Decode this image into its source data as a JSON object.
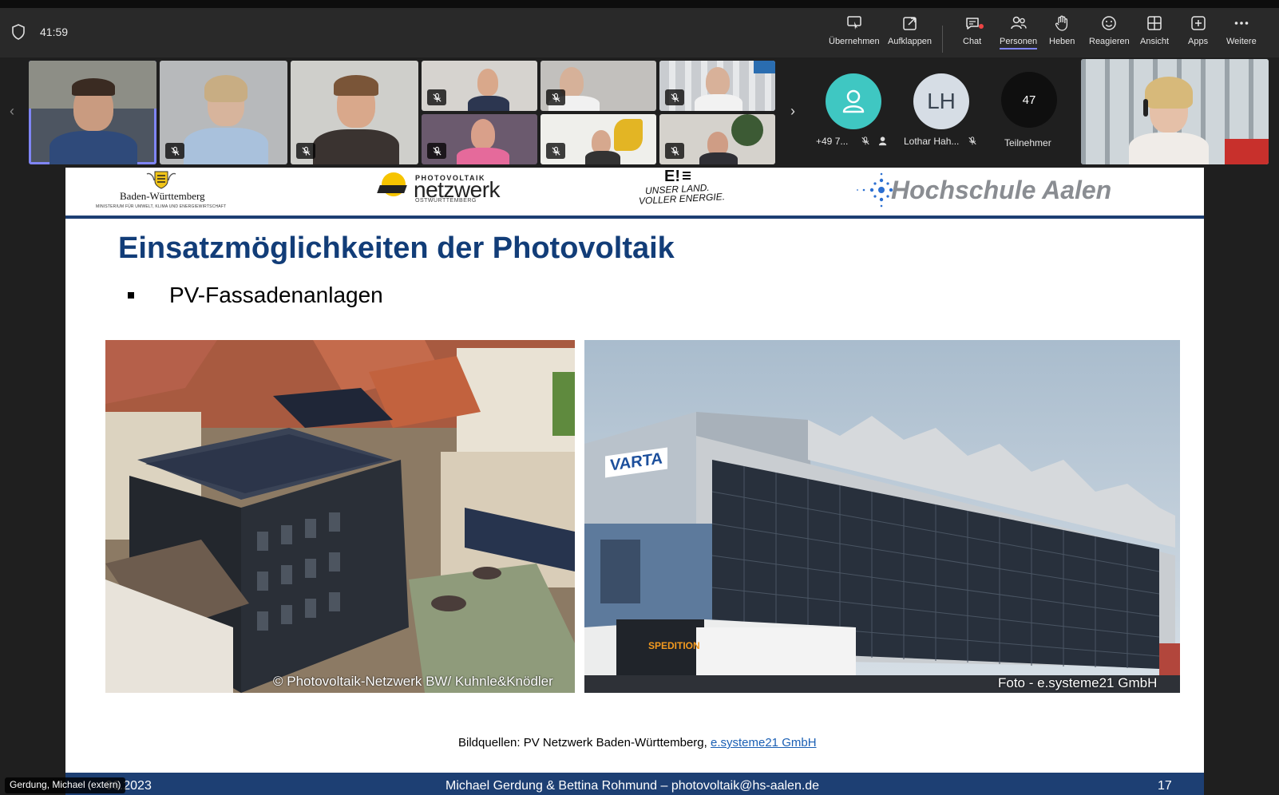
{
  "meeting": {
    "timer": "41:59"
  },
  "toolbar": {
    "buttons": [
      {
        "id": "take-control",
        "label": "Übernehmen",
        "icon": "take-control-icon"
      },
      {
        "id": "pop-out",
        "label": "Aufklappen",
        "icon": "pop-out-icon"
      },
      {
        "id": "chat",
        "label": "Chat",
        "icon": "chat-icon"
      },
      {
        "id": "people",
        "label": "Personen",
        "icon": "people-icon"
      },
      {
        "id": "raise",
        "label": "Heben",
        "icon": "raise-hand-icon"
      },
      {
        "id": "react",
        "label": "Reagieren",
        "icon": "react-icon"
      },
      {
        "id": "view",
        "label": "Ansicht",
        "icon": "view-icon"
      },
      {
        "id": "apps",
        "label": "Apps",
        "icon": "apps-icon"
      },
      {
        "id": "more",
        "label": "Weitere",
        "icon": "more-icon"
      }
    ],
    "active": "Personen",
    "colors": {
      "accent": "#7f85f5",
      "notification": "#e44444"
    }
  },
  "participants_strip": {
    "phone_avatar_label": "+49 7...",
    "lh_initials": "LH",
    "lh_label": "Lothar Hah...",
    "count": "47",
    "count_label": "Teilnehmer"
  },
  "slide": {
    "logos": {
      "bw_name": "Baden-Württemberg",
      "bw_sub": "MINISTERIUM FÜR UMWELT, KLIMA UND ENERGIEWIRTSCHAFT",
      "pv_top": "PHOTOVOLTAIK",
      "pv_main": "netzwerk",
      "pv_sub": "OSTWÜRTTEMBERG",
      "ee_mark": "E!",
      "ee_line1": "UNSER LAND.",
      "ee_line2": "VOLLER ENERGIE.",
      "hs_name": "Hochschule Aalen"
    },
    "title": "Einsatzmöglichkeiten der Photovoltaik",
    "bullet": "PV-Fassadenanlagen",
    "photo_left_caption": "© Photovoltaik-Netzwerk BW/ Kuhnle&Knödler",
    "photo_right_caption": "Foto - e.systeme21 GmbH",
    "photo_right_varta": "VARTA",
    "photo_right_truck": "SPEDITION",
    "sources_prefix": "Bildquellen: PV Netzwerk Baden-Württemberg, ",
    "sources_link": "e.systeme21 GmbH",
    "footer_date": "06.2023",
    "footer_author": "Michael Gerdung & Bettina Rohmund – photovoltaik@hs-aalen.de",
    "footer_page": "17"
  },
  "presenter_badge": "Gerdung, Michael (extern)"
}
